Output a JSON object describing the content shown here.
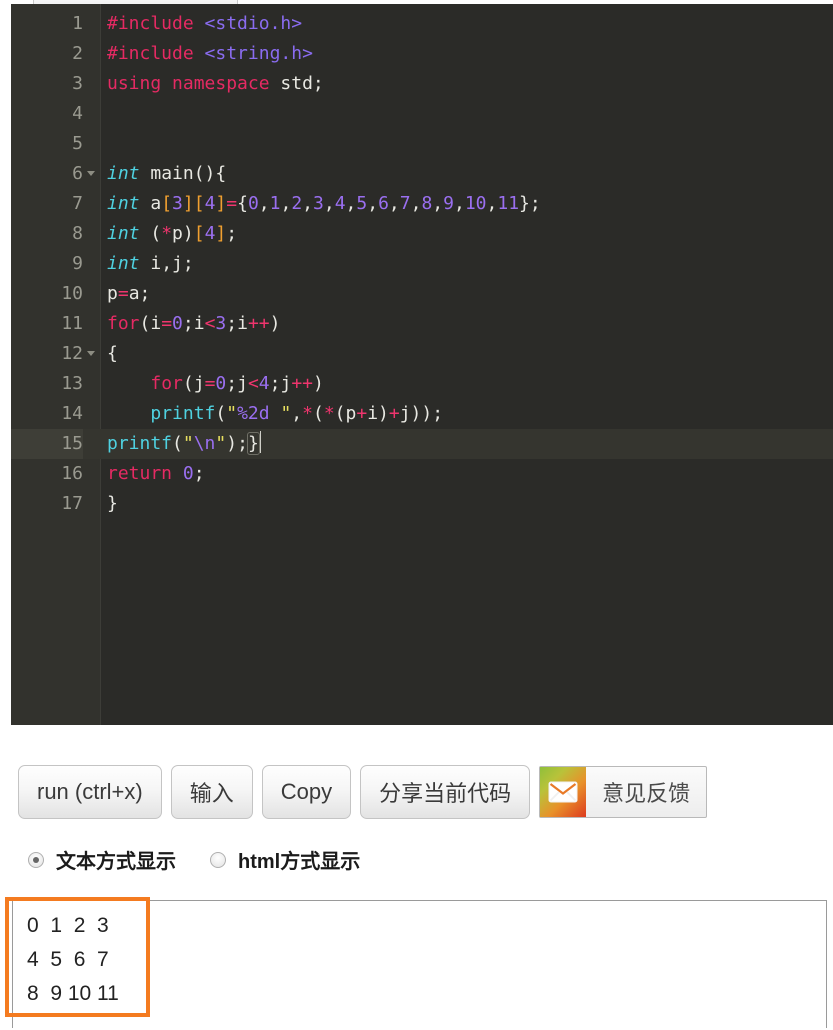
{
  "editor": {
    "tab_stub_name": "code-tab",
    "active_line": 15,
    "lines": [
      {
        "n": "1",
        "fold": false,
        "tokens": [
          {
            "t": "#include",
            "c": "t-pp"
          },
          {
            "t": " ",
            "c": "t-plain"
          },
          {
            "t": "<stdio.h>",
            "c": "t-hdr"
          }
        ]
      },
      {
        "n": "2",
        "fold": false,
        "tokens": [
          {
            "t": "#include",
            "c": "t-pp"
          },
          {
            "t": " ",
            "c": "t-plain"
          },
          {
            "t": "<string.h>",
            "c": "t-hdr"
          }
        ]
      },
      {
        "n": "3",
        "fold": false,
        "tokens": [
          {
            "t": "using namespace",
            "c": "t-pp"
          },
          {
            "t": " std;",
            "c": "t-plain"
          }
        ]
      },
      {
        "n": "4",
        "fold": false,
        "tokens": []
      },
      {
        "n": "5",
        "fold": false,
        "tokens": []
      },
      {
        "n": "6",
        "fold": true,
        "tokens": [
          {
            "t": "int",
            "c": "t-type"
          },
          {
            "t": " main(){",
            "c": "t-plain"
          }
        ]
      },
      {
        "n": "7",
        "fold": false,
        "tokens": [
          {
            "t": "int",
            "c": "t-type"
          },
          {
            "t": " a",
            "c": "t-plain"
          },
          {
            "t": "[",
            "c": "t-brk"
          },
          {
            "t": "3",
            "c": "t-num"
          },
          {
            "t": "]",
            "c": "t-brk"
          },
          {
            "t": "[",
            "c": "t-brk"
          },
          {
            "t": "4",
            "c": "t-num"
          },
          {
            "t": "]",
            "c": "t-brk"
          },
          {
            "t": "=",
            "c": "t-op"
          },
          {
            "t": "{",
            "c": "t-plain"
          },
          {
            "t": "0",
            "c": "t-num"
          },
          {
            "t": ",",
            "c": "t-plain"
          },
          {
            "t": "1",
            "c": "t-num"
          },
          {
            "t": ",",
            "c": "t-plain"
          },
          {
            "t": "2",
            "c": "t-num"
          },
          {
            "t": ",",
            "c": "t-plain"
          },
          {
            "t": "3",
            "c": "t-num"
          },
          {
            "t": ",",
            "c": "t-plain"
          },
          {
            "t": "4",
            "c": "t-num"
          },
          {
            "t": ",",
            "c": "t-plain"
          },
          {
            "t": "5",
            "c": "t-num"
          },
          {
            "t": ",",
            "c": "t-plain"
          },
          {
            "t": "6",
            "c": "t-num"
          },
          {
            "t": ",",
            "c": "t-plain"
          },
          {
            "t": "7",
            "c": "t-num"
          },
          {
            "t": ",",
            "c": "t-plain"
          },
          {
            "t": "8",
            "c": "t-num"
          },
          {
            "t": ",",
            "c": "t-plain"
          },
          {
            "t": "9",
            "c": "t-num"
          },
          {
            "t": ",",
            "c": "t-plain"
          },
          {
            "t": "10",
            "c": "t-num"
          },
          {
            "t": ",",
            "c": "t-plain"
          },
          {
            "t": "11",
            "c": "t-num"
          },
          {
            "t": "};",
            "c": "t-plain"
          }
        ]
      },
      {
        "n": "8",
        "fold": false,
        "tokens": [
          {
            "t": "int",
            "c": "t-type"
          },
          {
            "t": " (",
            "c": "t-plain"
          },
          {
            "t": "*",
            "c": "t-op"
          },
          {
            "t": "p)",
            "c": "t-plain"
          },
          {
            "t": "[",
            "c": "t-brk"
          },
          {
            "t": "4",
            "c": "t-num"
          },
          {
            "t": "]",
            "c": "t-brk"
          },
          {
            "t": ";",
            "c": "t-plain"
          }
        ]
      },
      {
        "n": "9",
        "fold": false,
        "tokens": [
          {
            "t": "int",
            "c": "t-type"
          },
          {
            "t": " i,j;",
            "c": "t-plain"
          }
        ]
      },
      {
        "n": "10",
        "fold": false,
        "tokens": [
          {
            "t": "p",
            "c": "t-plain"
          },
          {
            "t": "=",
            "c": "t-op"
          },
          {
            "t": "a;",
            "c": "t-plain"
          }
        ]
      },
      {
        "n": "11",
        "fold": false,
        "tokens": [
          {
            "t": "for",
            "c": "t-pp"
          },
          {
            "t": "(i",
            "c": "t-plain"
          },
          {
            "t": "=",
            "c": "t-op"
          },
          {
            "t": "0",
            "c": "t-num"
          },
          {
            "t": ";i",
            "c": "t-plain"
          },
          {
            "t": "<",
            "c": "t-op"
          },
          {
            "t": "3",
            "c": "t-num"
          },
          {
            "t": ";i",
            "c": "t-plain"
          },
          {
            "t": "++",
            "c": "t-op"
          },
          {
            "t": ")",
            "c": "t-plain"
          }
        ]
      },
      {
        "n": "12",
        "fold": true,
        "tokens": [
          {
            "t": "{",
            "c": "t-plain"
          }
        ]
      },
      {
        "n": "13",
        "fold": false,
        "tokens": [
          {
            "t": "    ",
            "c": "t-plain"
          },
          {
            "t": "for",
            "c": "t-pp"
          },
          {
            "t": "(j",
            "c": "t-plain"
          },
          {
            "t": "=",
            "c": "t-op"
          },
          {
            "t": "0",
            "c": "t-num"
          },
          {
            "t": ";j",
            "c": "t-plain"
          },
          {
            "t": "<",
            "c": "t-op"
          },
          {
            "t": "4",
            "c": "t-num"
          },
          {
            "t": ";j",
            "c": "t-plain"
          },
          {
            "t": "++",
            "c": "t-op"
          },
          {
            "t": ")",
            "c": "t-plain"
          }
        ]
      },
      {
        "n": "14",
        "fold": false,
        "tokens": [
          {
            "t": "    ",
            "c": "t-plain"
          },
          {
            "t": "printf",
            "c": "t-fn"
          },
          {
            "t": "(",
            "c": "t-plain"
          },
          {
            "t": "\"",
            "c": "t-str"
          },
          {
            "t": "%2d",
            "c": "t-num"
          },
          {
            "t": " ",
            "c": "t-plain"
          },
          {
            "t": "\"",
            "c": "t-str"
          },
          {
            "t": ",",
            "c": "t-plain"
          },
          {
            "t": "*",
            "c": "t-op"
          },
          {
            "t": "(",
            "c": "t-plain"
          },
          {
            "t": "*",
            "c": "t-op"
          },
          {
            "t": "(p",
            "c": "t-plain"
          },
          {
            "t": "+",
            "c": "t-op"
          },
          {
            "t": "i)",
            "c": "t-plain"
          },
          {
            "t": "+",
            "c": "t-op"
          },
          {
            "t": "j));",
            "c": "t-plain"
          }
        ]
      },
      {
        "n": "15",
        "fold": false,
        "tokens": [
          {
            "t": "printf",
            "c": "t-fn"
          },
          {
            "t": "(",
            "c": "t-plain"
          },
          {
            "t": "\"",
            "c": "t-str"
          },
          {
            "t": "\\n",
            "c": "t-num"
          },
          {
            "t": "\"",
            "c": "t-str"
          },
          {
            "t": ");",
            "c": "t-plain"
          },
          {
            "t": "}",
            "c": "t-plain brace-match"
          }
        ],
        "caret": true
      },
      {
        "n": "16",
        "fold": false,
        "tokens": [
          {
            "t": "return",
            "c": "t-pp"
          },
          {
            "t": " ",
            "c": "t-plain"
          },
          {
            "t": "0",
            "c": "t-num"
          },
          {
            "t": ";",
            "c": "t-plain"
          }
        ]
      },
      {
        "n": "17",
        "fold": false,
        "tokens": [
          {
            "t": "}",
            "c": "t-plain"
          }
        ]
      }
    ]
  },
  "toolbar": {
    "buttons": [
      {
        "label": "run (ctrl+x)",
        "name": "run-button"
      },
      {
        "label": "输入",
        "name": "input-button"
      },
      {
        "label": "Copy",
        "name": "copy-button"
      },
      {
        "label": "分享当前代码",
        "name": "share-code-button"
      }
    ],
    "feedback": {
      "label": "意见反馈",
      "icon": "mail-icon"
    }
  },
  "display_mode": {
    "options": [
      {
        "label": "文本方式显示",
        "checked": true
      },
      {
        "label": "html方式显示",
        "checked": false
      }
    ]
  },
  "output": {
    "text": "0  1  2  3\n4  5  6  7\n8  9 10 11",
    "annotation_color": "#f47b20"
  },
  "colors": {
    "editor_bg": "#2b2b28",
    "gutter_bg": "#32322d",
    "active_line": "#35352f",
    "accent_orange": "#f47b20"
  }
}
